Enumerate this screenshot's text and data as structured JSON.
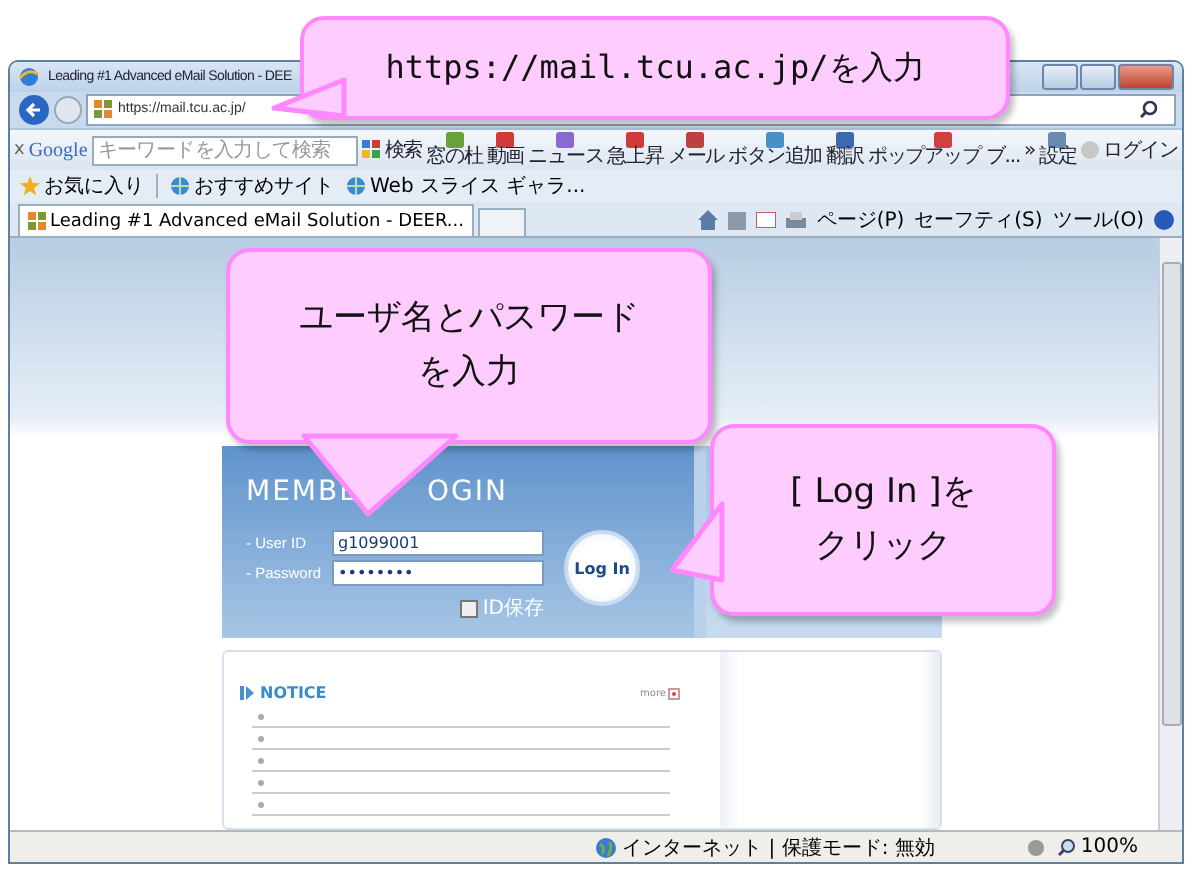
{
  "window": {
    "title": "Leading #1 Advanced eMail Solution - DEE"
  },
  "address_bar": {
    "url": "https://mail.tcu.ac.jp/"
  },
  "google_toolbar": {
    "close": "x",
    "logo": "Google",
    "search_placeholder": "キーワードを入力して検索",
    "buttons": [
      {
        "label": "検索",
        "kind": "inline"
      },
      {
        "label": "窓の杜",
        "kind": "stacked"
      },
      {
        "label": "動画",
        "kind": "stacked"
      },
      {
        "label": "ニュース",
        "kind": "stacked"
      },
      {
        "label": "急上昇",
        "kind": "stacked"
      },
      {
        "label": "メール",
        "kind": "stacked"
      },
      {
        "label": "ボタン追加",
        "kind": "stacked"
      },
      {
        "label": "翻訳",
        "kind": "stacked"
      },
      {
        "label": "ポップアップ ブ...",
        "kind": "stacked"
      },
      {
        "label": "»",
        "kind": "plain"
      },
      {
        "label": "設定",
        "kind": "stacked"
      },
      {
        "label": "ログイン",
        "kind": "inline"
      }
    ]
  },
  "favorites_bar": {
    "items": [
      "お気に入り",
      "おすすめサイト",
      "Web スライス ギャラ..."
    ]
  },
  "tabs": [
    {
      "label": "Leading #1 Advanced eMail Solution - DEER...",
      "selected": true
    }
  ],
  "command_bar": {
    "menus": [
      "ページ(P)",
      "セーフティ(S)",
      "ツール(O)"
    ]
  },
  "login_form": {
    "title_parts": [
      "MEMBE",
      "OGIN"
    ],
    "fields": [
      {
        "label": "- User ID",
        "value": "g1099001"
      },
      {
        "label": "- Password",
        "value": "••••••••"
      }
    ],
    "remember": {
      "label": "ID保存",
      "checked": false
    },
    "button": "Log In"
  },
  "notice": {
    "title": "NOTICE",
    "more": "more"
  },
  "status_bar": {
    "zone": "インターネット | 保護モード: 無効",
    "zoom": "100%"
  },
  "callouts": [
    {
      "text": "https://mail.tcu.ac.jp/を入力"
    },
    {
      "text": "ユーザ名とパスワードを入力"
    },
    {
      "text": "[ Log In ]をクリック"
    }
  ]
}
